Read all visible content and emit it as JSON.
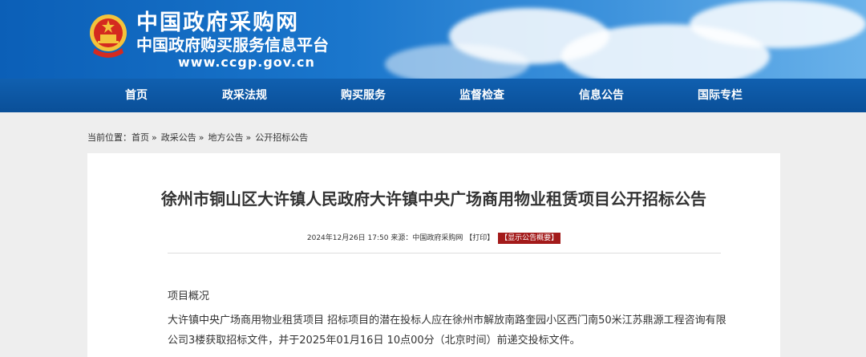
{
  "header": {
    "title": "中国政府采购网",
    "subtitle": "中国政府购买服务信息平台",
    "url": "www.ccgp.gov.cn",
    "emblem_icon": "national-emblem-icon",
    "colors": {
      "banner": "#1a76cc",
      "nav": "#0a4f98"
    }
  },
  "nav": {
    "items": [
      {
        "label": "首页"
      },
      {
        "label": "政采法规"
      },
      {
        "label": "购买服务"
      },
      {
        "label": "监督检查"
      },
      {
        "label": "信息公告"
      },
      {
        "label": "国际专栏"
      }
    ]
  },
  "breadcrumb": {
    "prefix": "当前位置：",
    "items": [
      "首页",
      "政采公告",
      "地方公告",
      "公开招标公告"
    ],
    "separator": "»"
  },
  "article": {
    "title": "徐州市铜山区大许镇人民政府大许镇中央广场商用物业租赁项目公开招标公告",
    "meta_text": "2024年12月26日 17:50 来源：中国政府采购网",
    "print_label": "【打印】",
    "summary_label": "【显示公告概要】",
    "summary_color": "#a31a1a",
    "section_heading": "项目概况",
    "paragraph": "大许镇中央广场商用物业租赁项目 招标项目的潜在投标人应在徐州市解放南路奎园小区西门南50米江苏鼎源工程咨询有限公司3楼获取招标文件，并于2025年01月16日 10点00分（北京时间）前递交投标文件。"
  }
}
